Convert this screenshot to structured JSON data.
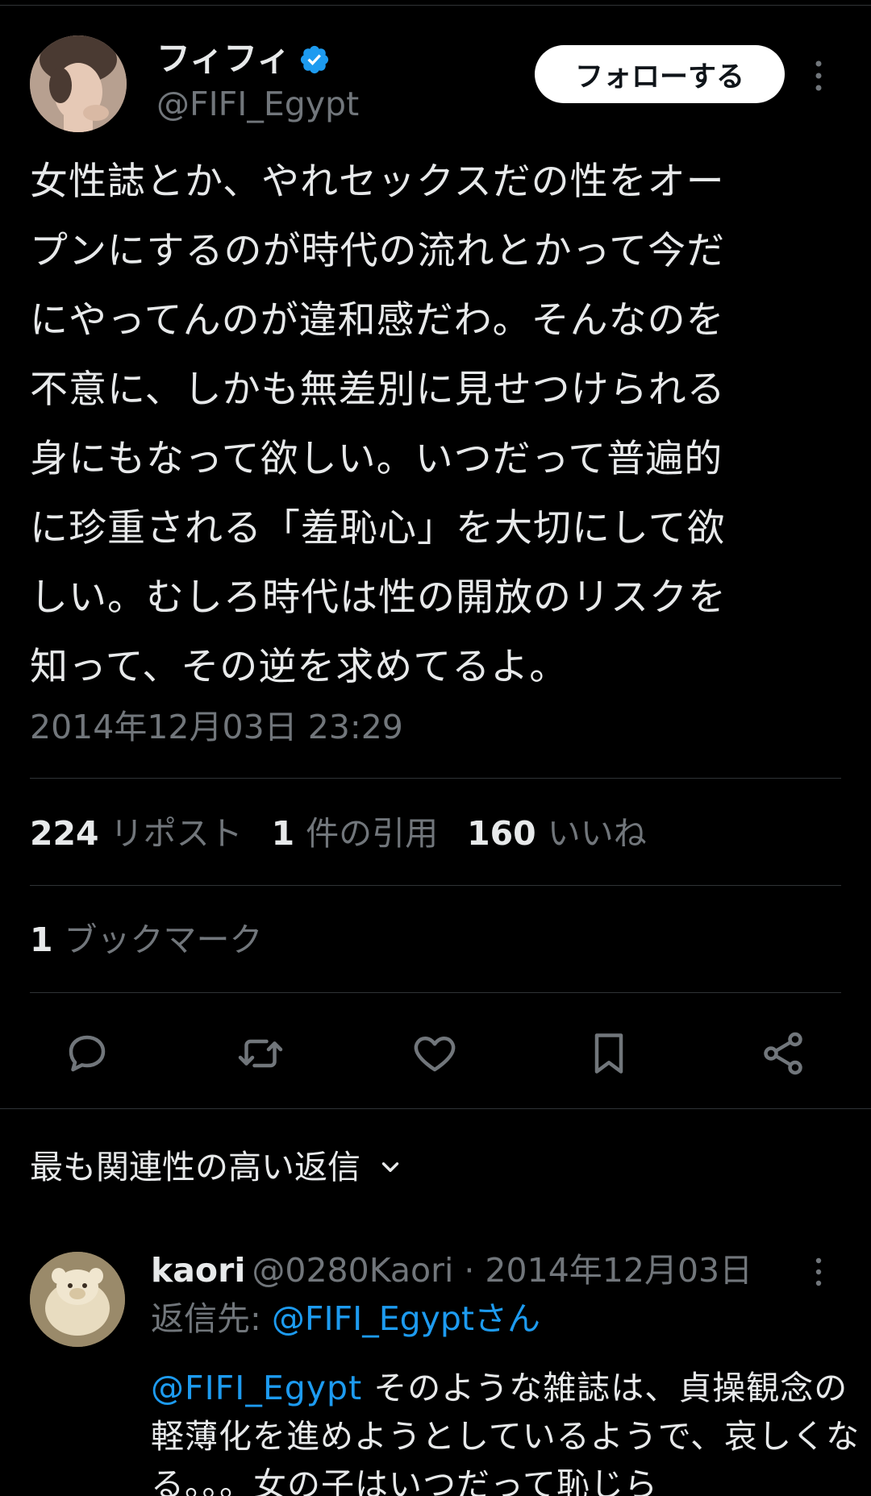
{
  "tweet": {
    "author": {
      "display_name": "フィフィ",
      "handle": "@FIFI_Egypt",
      "verified": true,
      "follow_label": "フォローする"
    },
    "text": "女性誌とか、やれセックスだの性をオー\nプンにするのが時代の流れとかって今だ\nにやってんのが違和感だわ。そんなのを\n不意に、しかも無差別に見せつけられる\n身にもなって欲しい。いつだって普遍的\nに珍重される「羞恥心」を大切にして欲\nしい。むしろ時代は性の開放のリスクを\n知って、その逆を求めてるよ。",
    "timestamp": "2014年12月03日 23:29",
    "stats": {
      "reposts_count": "224",
      "reposts_label": "リポスト",
      "quotes_count": "1",
      "quotes_label": "件の引用",
      "likes_count": "160",
      "likes_label": "いいね",
      "bookmarks_count": "1",
      "bookmarks_label": "ブックマーク"
    },
    "actions": [
      "reply-icon",
      "retweet-icon",
      "heart-icon",
      "bookmark-icon",
      "share-icon"
    ]
  },
  "replies_section": {
    "sort_label": "最も関連性の高い返信"
  },
  "reply": {
    "name": "kaori",
    "meta": "@0280Kaori · 2014年12月03日",
    "reply_to_prefix": "返信先: ",
    "reply_to_handle": "@FIFI_Egyptさん",
    "mention": "@FIFI_Egypt",
    "body": " そのような雑誌は、貞操観念の軽薄化を進めようとしているようで、哀しくなる。。。女の子はいつだって恥じら"
  },
  "colors": {
    "background": "#000000",
    "text": "#e7e9ea",
    "muted": "#71767b",
    "link": "#1d9bf0",
    "divider": "#2f3336"
  }
}
